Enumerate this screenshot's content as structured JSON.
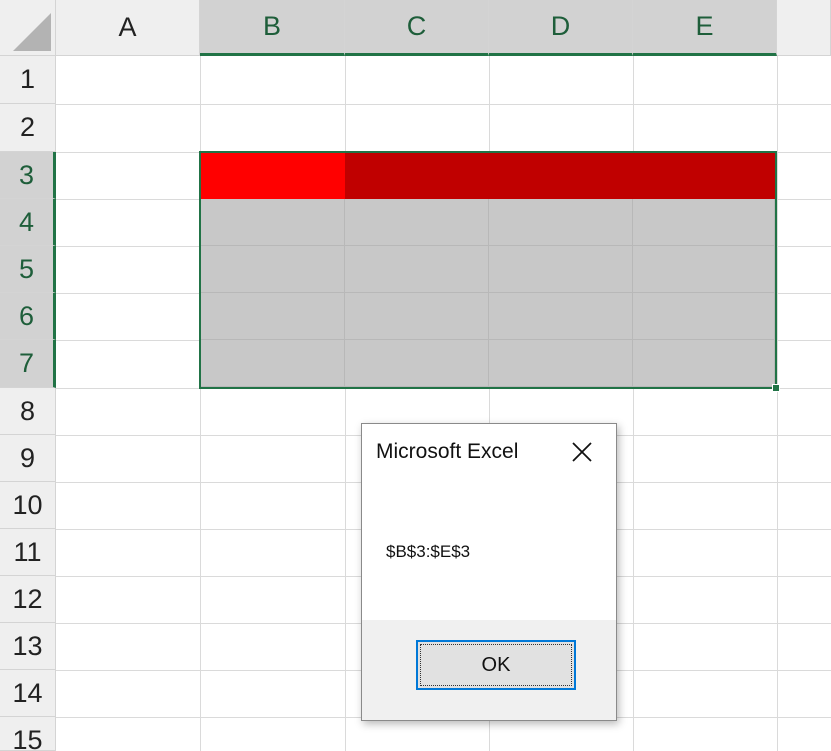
{
  "spreadsheet": {
    "columns": [
      "A",
      "B",
      "C",
      "D",
      "E"
    ],
    "selected_columns": [
      "B",
      "C",
      "D",
      "E"
    ],
    "rows": [
      "1",
      "2",
      "3",
      "4",
      "5",
      "6",
      "7",
      "8",
      "9",
      "10",
      "11",
      "12",
      "13",
      "14",
      "15"
    ],
    "selected_rows": [
      "3",
      "4",
      "5",
      "6",
      "7"
    ],
    "colors": {
      "header_row_fill_first": "#ff0000",
      "header_row_fill": "#c00000",
      "table_body_fill": "#c8c8c8",
      "selection_border": "#217346"
    }
  },
  "dialog": {
    "title": "Microsoft Excel",
    "message": "$B$3:$E$3",
    "ok_label": "OK",
    "close_icon": "close-icon"
  }
}
